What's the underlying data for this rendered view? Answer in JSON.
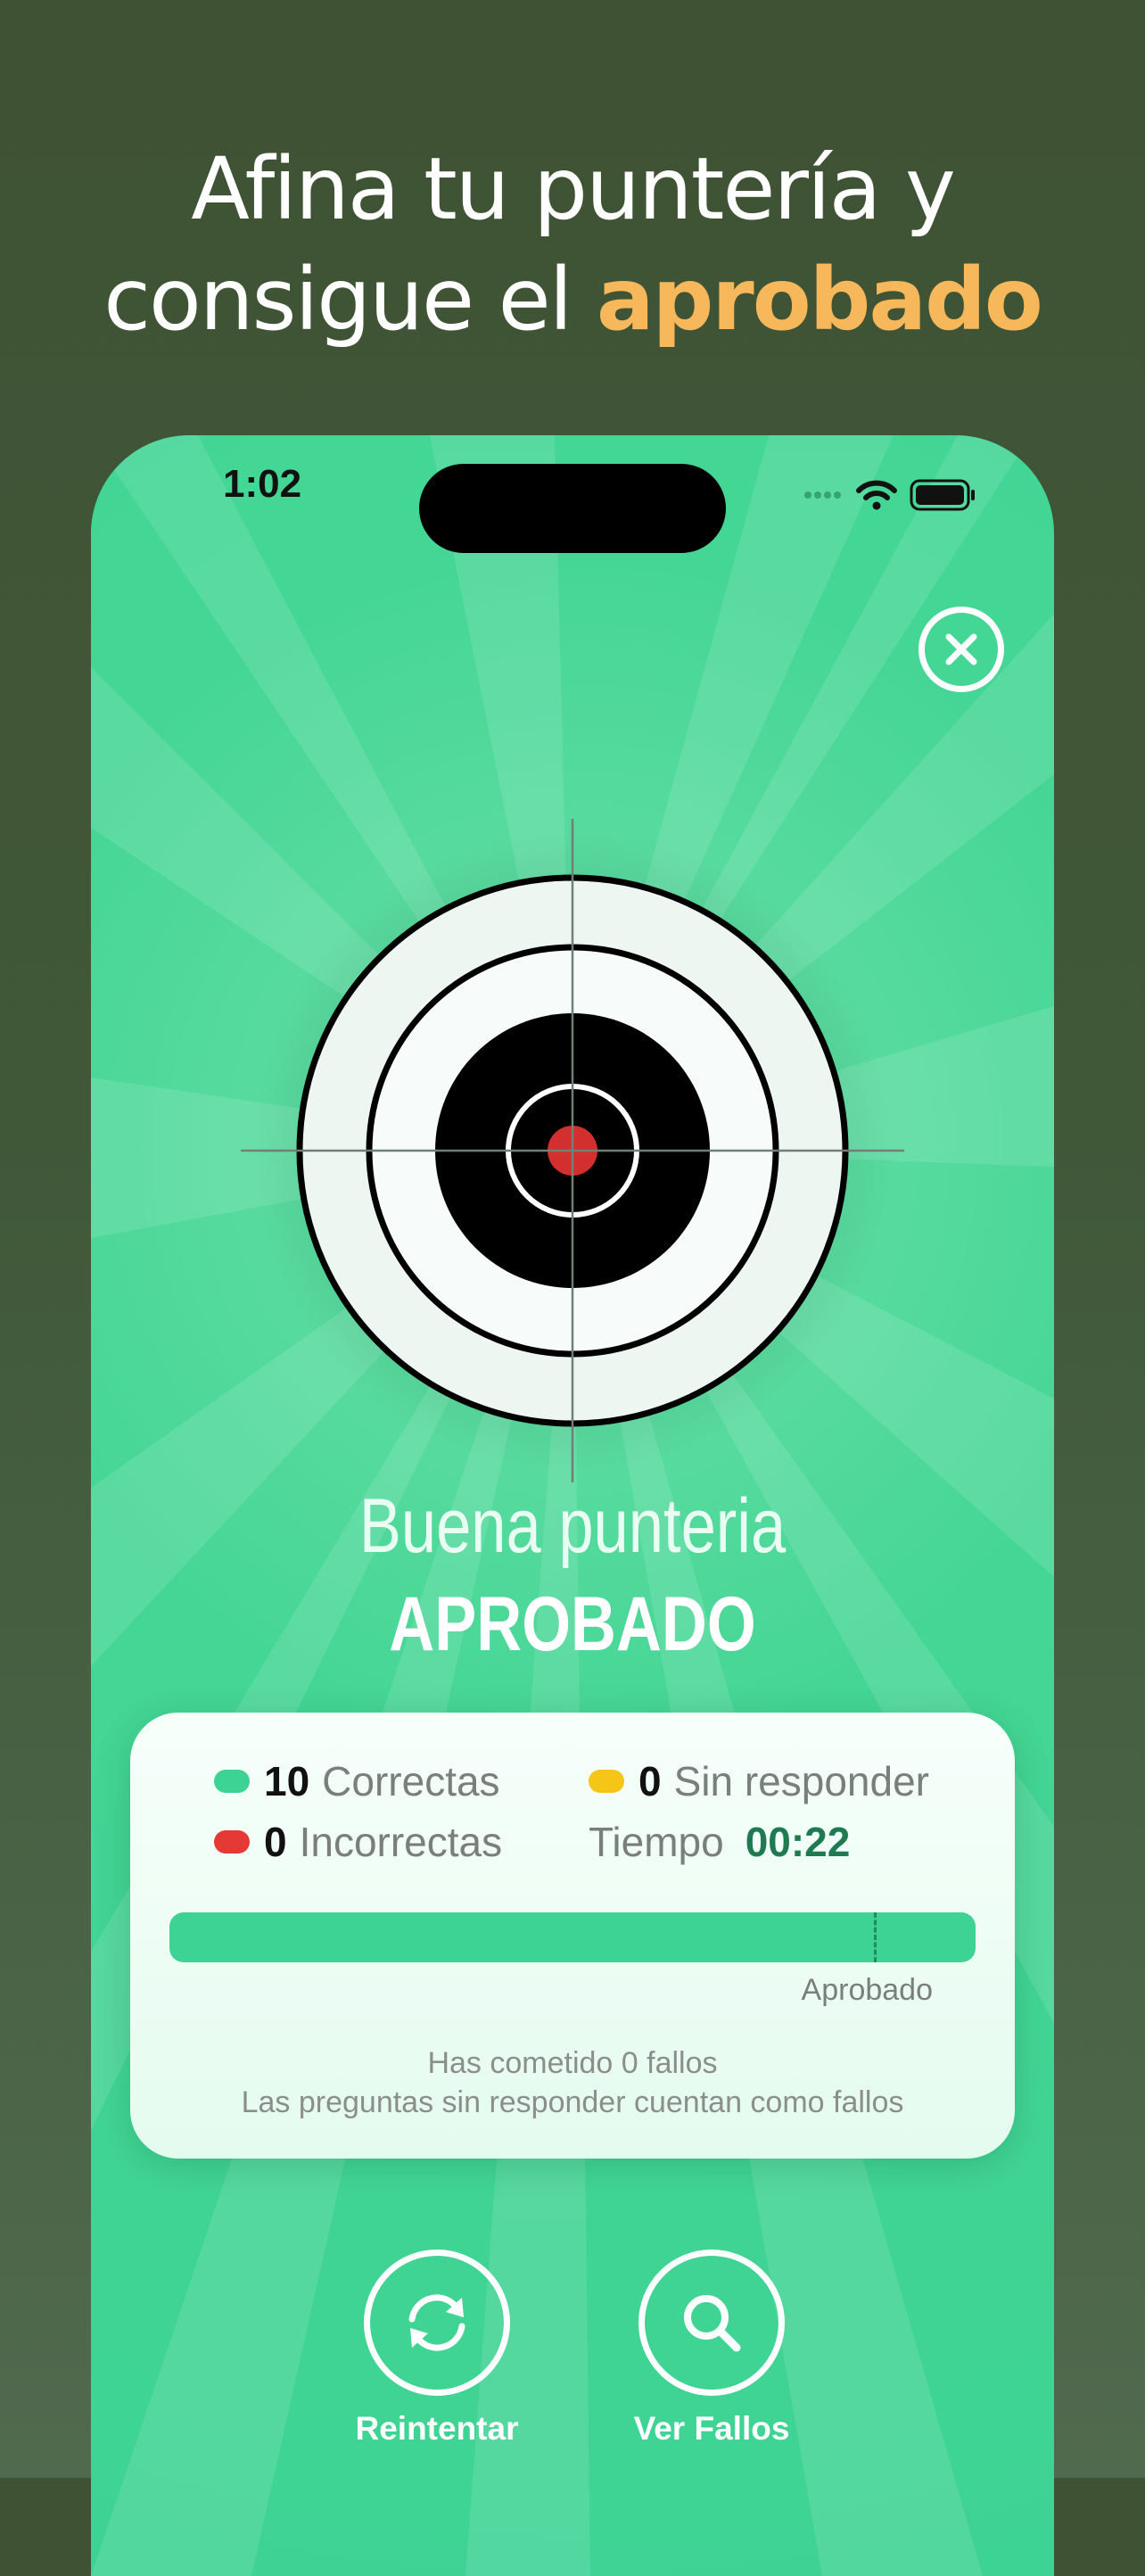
{
  "headline": {
    "line1": "Afina tu puntería y",
    "line2_prefix": "consigue el ",
    "line2_accent": "aprobado"
  },
  "status_bar": {
    "time": "1:02"
  },
  "icons": {
    "close": "close-icon",
    "wifi": "wifi-icon",
    "battery": "battery-icon",
    "retry": "refresh-icon",
    "search": "search-icon"
  },
  "result": {
    "subtitle": "Buena punteria",
    "title": "APROBADO"
  },
  "stats": {
    "correct_count": "10",
    "correct_label": "Correctas",
    "unanswered_count": "0",
    "unanswered_label": "Sin responder",
    "incorrect_count": "0",
    "incorrect_label": "Incorrectas",
    "time_label": "Tiempo",
    "time_value": "00:22"
  },
  "progress": {
    "pass_label": "Aprobado",
    "correct_fraction": 1.0
  },
  "notes": {
    "line1": "Has cometido 0 fallos",
    "line2": "Las preguntas sin responder cuentan como fallos"
  },
  "actions": {
    "retry_label": "Reintentar",
    "review_label": "Ver Fallos"
  },
  "colors": {
    "accent": "#f7b85c",
    "green": "#3dd394",
    "correct": "#3dd394",
    "incorrect": "#e53935",
    "unanswered": "#f5c518",
    "bullseye": "#d32f2f"
  }
}
